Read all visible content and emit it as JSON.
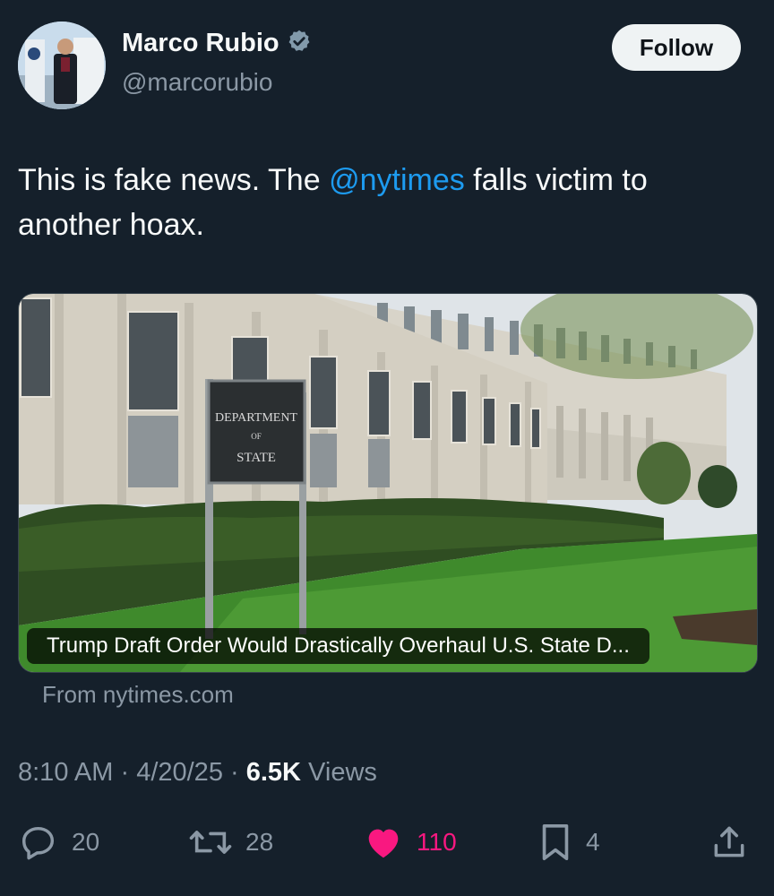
{
  "author": {
    "display_name": "Marco Rubio",
    "handle": "@marcorubio",
    "verified_icon": "verified-badge-icon"
  },
  "follow_label": "Follow",
  "tweet": {
    "text_before": "This is fake news. The ",
    "mention": "@nytimes",
    "text_after": " falls victim to another hoax."
  },
  "card": {
    "headline": "Trump Draft Order Would Drastically Overhaul U.S. State D...",
    "sign_line1": "DEPARTMENT",
    "sign_line2": "OF",
    "sign_line3": "STATE",
    "source": "From nytimes.com"
  },
  "meta": {
    "time": "8:10 AM",
    "sep1": " · ",
    "date": "4/20/25",
    "sep2": " · ",
    "views_count": "6.5K",
    "views_label": " Views"
  },
  "actions": {
    "replies": "20",
    "reposts": "28",
    "likes": "110",
    "bookmarks": "4"
  },
  "colors": {
    "background": "#15202b",
    "link": "#1d9bf0",
    "like": "#f91880",
    "muted": "#8b98a5"
  }
}
